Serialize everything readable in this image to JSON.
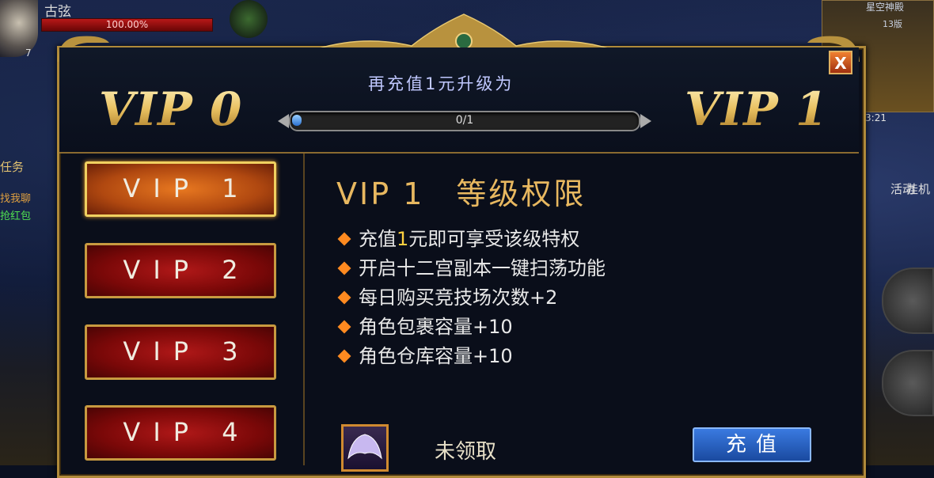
{
  "hud": {
    "player_name": "古弦",
    "hp_text": "100.00%",
    "level": "7",
    "map_name": "星空神殿",
    "map_coord": "13版",
    "clock": "13:21",
    "left_side": [
      "任务",
      "找我聊",
      "抢红包"
    ],
    "right_side": [
      "活动",
      "挂机"
    ]
  },
  "header": {
    "current_vip": "VIP 0",
    "next_vip": "VIP 1",
    "upgrade_text": "再充值1元升级为",
    "progress_text": "0/1",
    "progress_value": 0,
    "close_label": "X"
  },
  "tabs": [
    {
      "label": "VIP 1",
      "active": true
    },
    {
      "label": "VIP 2",
      "active": false
    },
    {
      "label": "VIP 3",
      "active": false
    },
    {
      "label": "VIP 4",
      "active": false
    }
  ],
  "privileges": {
    "title_vip": "VIP 1",
    "title_text": "等级权限",
    "items": [
      {
        "pre": "充值",
        "hl": "1",
        "post": "元即可享受该级特权"
      },
      {
        "pre": "开启十二宫副本一键扫荡功能",
        "hl": "",
        "post": ""
      },
      {
        "pre": "每日购买竞技场次数+2",
        "hl": "",
        "post": ""
      },
      {
        "pre": "角色包裹容量+10",
        "hl": "",
        "post": ""
      },
      {
        "pre": "角色仓库容量+10",
        "hl": "",
        "post": ""
      }
    ]
  },
  "reward": {
    "status": "未领取",
    "recharge_label": "充值"
  },
  "colors": {
    "gold": "#e8b860",
    "accent_orange": "#ff8a20",
    "button_blue": "#2a5ac0"
  }
}
